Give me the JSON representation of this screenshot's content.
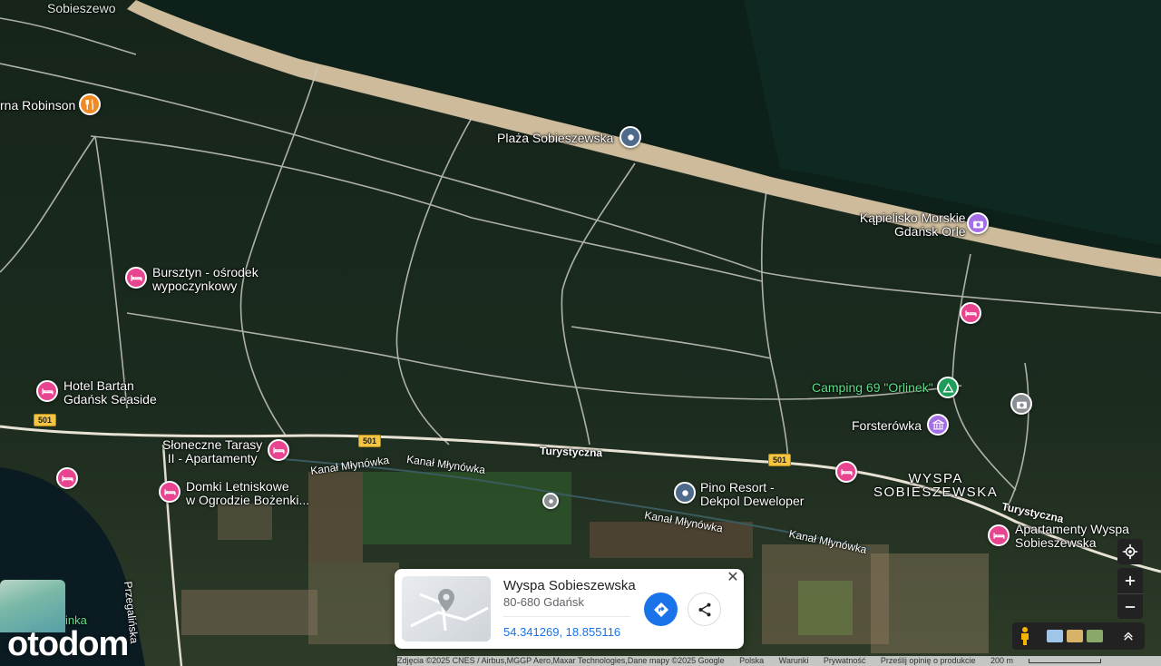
{
  "labels": {
    "sobieszewo": "Sobieszewo",
    "robinson": "rna Robinson",
    "plaza": "Plaża Sobieszewska",
    "kapielisko_1": "Kąpielisko Morskie",
    "kapielisko_2": "Gdańsk Orle",
    "bursztyn_1": "Bursztyn - ośrodek",
    "bursztyn_2": "wypoczynkowy",
    "bartan_1": "Hotel Bartan",
    "bartan_2": "Gdańsk Seaside",
    "camping": "Camping 69 \"Orlinek\"",
    "forsterowka": "Forsterówka",
    "tarasy_1": "Słoneczne Tarasy",
    "tarasy_2": "II - Apartamenty",
    "domki_1": "Domki Letniskowe",
    "domki_2": "w Ogrodzie Bożenki...",
    "pino_1": "Pino Resort -",
    "pino_2": "Dekpol Deweloper",
    "wyspa_1": "WYSPA",
    "wyspa_2": "SOBIESZEWSKA",
    "apart_1": "Apartamenty Wyspa",
    "apart_2": "Sobieszewska",
    "kanal_1": "Kanał Młynówka",
    "kanal_2": "Kanał Młynówka",
    "kanal_3": "Kanał Młynówka",
    "kanal_4": "Kanał Młynówka",
    "turystyczna_1": "Turystyczna",
    "turystyczna_2": "Turystyczna",
    "przegalinska": "Przegalińska",
    "inka": "inka",
    "route_501": "501"
  },
  "card": {
    "title": "Wyspa Sobieszewska",
    "address": "80-680 Gdańsk",
    "coords": "54.341269, 18.855116",
    "close": "✕"
  },
  "attribution": {
    "imagery": "Zdjęcia ©2025 CNES / Airbus,MGGP Aero,Maxar Technologies,Dane mapy ©2025 Google",
    "country": "Polska",
    "terms": "Warunki",
    "privacy": "Prywatność",
    "feedback": "Prześlij opinię o produkcie",
    "scale": "200 m"
  },
  "logo": "otodom",
  "icons": {
    "hotel": "bed-icon",
    "food": "fork-knife-icon",
    "poi": "location-pin-icon",
    "photo": "camera-icon",
    "camp": "tent-icon",
    "museum": "museum-icon"
  },
  "colors": {
    "hotel_pin": "#e8448f",
    "food_pin": "#f08a24",
    "photo_pin": "#a46ee6",
    "camp_pin": "#1e9c5a",
    "link": "#1a73e8"
  }
}
